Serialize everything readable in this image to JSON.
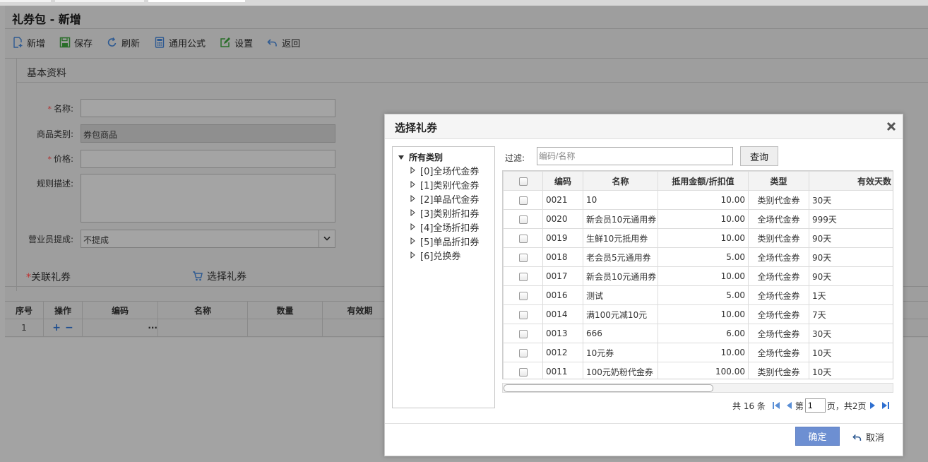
{
  "page": {
    "title": "礼券包 - 新增",
    "toolbar": {
      "new": "新增",
      "save": "保存",
      "refresh": "刷新",
      "formula": "通用公式",
      "settings": "设置",
      "back": "返回"
    },
    "section_title": "基本资料",
    "form": {
      "name_label": "名称:",
      "name_value": "",
      "category_label": "商品类别:",
      "category_value": "券包商品",
      "price_label": "价格:",
      "price_value": "",
      "desc_label": "规则描述:",
      "desc_value": "",
      "commission_label": "营业员提成:",
      "commission_value": "不提成"
    },
    "related_title": "关联礼券",
    "choose_coupon": "选择礼券",
    "subgrid": {
      "headers": [
        "序号",
        "操作",
        "编码",
        "名称",
        "数量",
        "有效期"
      ],
      "rows": [
        {
          "index": "1",
          "ops_plus": "+",
          "ops_minus": "−",
          "ellipsis": "···"
        }
      ]
    }
  },
  "dialog": {
    "title": "选择礼券",
    "tree": {
      "root": "所有类别",
      "items": [
        "[0]全场代金券",
        "[1]类别代金券",
        "[2]单品代金券",
        "[3]类别折扣券",
        "[4]全场折扣券",
        "[5]单品折扣券",
        "[6]兑换券"
      ]
    },
    "filter_label": "过滤:",
    "filter_placeholder": "编码/名称",
    "query_label": "查询",
    "grid": {
      "headers": [
        "编码",
        "名称",
        "抵用金额/折扣值",
        "类型",
        "有效天数"
      ],
      "rows": [
        [
          "0021",
          "10",
          "10.00",
          "类别代金券",
          "30天"
        ],
        [
          "0020",
          "新会员10元通用券",
          "10.00",
          "全场代金券",
          "999天"
        ],
        [
          "0019",
          "生鲜10元抵用券",
          "10.00",
          "类别代金券",
          "90天"
        ],
        [
          "0018",
          "老会员5元通用券",
          "5.00",
          "全场代金券",
          "90天"
        ],
        [
          "0017",
          "新会员10元通用券",
          "10.00",
          "全场代金券",
          "90天"
        ],
        [
          "0016",
          "测试",
          "5.00",
          "全场代金券",
          "1天"
        ],
        [
          "0014",
          "满100元减10元",
          "10.00",
          "全场代金券",
          "7天"
        ],
        [
          "0013",
          "666",
          "6.00",
          "全场代金券",
          "30天"
        ],
        [
          "0012",
          "10元券",
          "10.00",
          "全场代金券",
          "10天"
        ],
        [
          "0011",
          "100元奶粉代金券",
          "100.00",
          "类别代金券",
          "10天"
        ]
      ]
    },
    "pager": {
      "total": "共 16 条",
      "page_prefix": "第",
      "page_value": "1",
      "page_suffix": "页，共2页"
    },
    "ok_label": "确定",
    "cancel_label": "取消"
  },
  "colors": {
    "primary_button": "#6d8fd2",
    "icon_blue": "#3a6fb5",
    "icon_green": "#2e8b3a",
    "required": "#c03030"
  }
}
